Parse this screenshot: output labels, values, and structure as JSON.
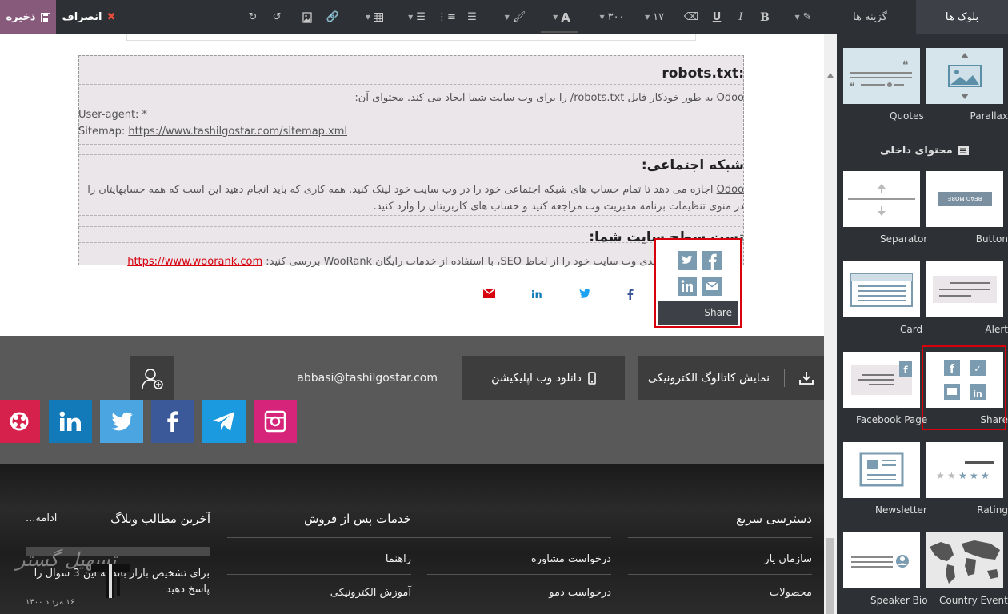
{
  "toolbar": {
    "save_label": "ذخیره",
    "discard_label": "انصراف",
    "font_size": "۱۷",
    "weight": "۳۰۰",
    "bold": "B",
    "italic": "I",
    "underline": "U",
    "font_color": "A"
  },
  "sidebar": {
    "tabs": {
      "blocks": "بلوک ها",
      "options": "گزینه ها"
    },
    "section_inner": "محتوای داخلی",
    "snippets": {
      "parallax": "Parallax",
      "quotes": "Quotes",
      "button": "Button",
      "separator": "Separator",
      "alert": "Alert",
      "card": "Card",
      "share": "Share",
      "facebook_page": "Facebook Page",
      "rating": "Rating",
      "newsletter": "Newsletter",
      "country_events": "Country Events",
      "speaker_bio": "Speaker Bio"
    },
    "button_thumb_text": "READ MORE"
  },
  "content": {
    "robots_heading": ":robots.txt",
    "robots_para_a": "Odoo",
    "robots_para_b": " به طور خودکار فایل ",
    "robots_para_link": "robots.txt",
    "robots_para_c": "/ را برای وب سایت شما ایجاد می کند. محتوای آن:",
    "user_agent": "User-agent: *",
    "sitemap_label": "Sitemap: ",
    "sitemap_url": "https://www.tashilgostar.com/sitemap.xml",
    "social_heading": "شبکه اجتماعی:",
    "social_para_a": "Odoo",
    "social_para_b": " اجازه می دهد تا تمام حساب های شبکه اجتماعی خود را در وب سایت خود لینک کنید. همه کاری که باید انجام دهید این است که همه حسابهایتان را در منوی تنظیمات برنامه مدیریت وب مراجعه کنید و حساب های کاربریتان را وارد کنید.",
    "test_heading": "تست سطح سایت شما:",
    "test_para": "ندی وب سایت خود را از لحاظ SEO، با استفاده از خدمات رایگان WooRank بررسی کنید: ",
    "woorank_url": "https://www.woorank.com"
  },
  "share_popup": {
    "label": "Share"
  },
  "footer": {
    "catalog_label": "نمایش کاتالوگ الکترونیکی",
    "app_label": "دانلود وب اپلیکیشن",
    "email": "abbasi@tashilgostar.com"
  },
  "bottom": {
    "quick_access_title": "دسترسی سریع",
    "quick_links": [
      "سازمان یار",
      "محصولات"
    ],
    "after_sales_title": "خدمات پس از فروش",
    "after_sales_col2": [
      "درخواست مشاوره",
      "درخواست دمو"
    ],
    "after_sales_col1": [
      "راهنما",
      "آموزش الکترونیکی"
    ],
    "blog_title": "آخرین مطالب وبلاگ",
    "blog_more": "ادامه...",
    "blog_text": "برای تشخیص بازار باید به این 3 سوال را پاسخ دهید",
    "blog_date": "۱۶ مرداد ۱۴۰۰",
    "watermark": "تسهیل گستر"
  },
  "colors": {
    "toolbar_bg": "#2d3035",
    "save_bg": "#875a7b",
    "highlight_red": "#d9000d",
    "link_red": "#d9000d",
    "footer_bg": "#595959"
  }
}
